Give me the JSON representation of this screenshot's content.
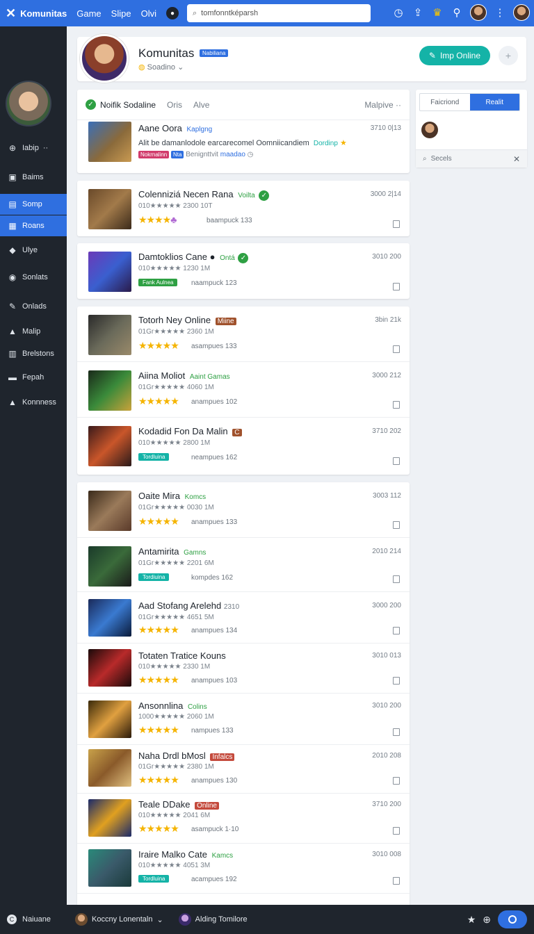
{
  "topbar": {
    "logo": "✕",
    "brand": "Komunitas",
    "nav": [
      "Game",
      "Slipe",
      "Olvi"
    ],
    "search_placeholder": "tomfonntképarsh",
    "icons": [
      "clock-icon",
      "upload-icon",
      "trophy-icon",
      "cart-icon",
      "more-icon"
    ]
  },
  "sidebar": {
    "items": [
      {
        "label": "Iabip",
        "icon": "⊕",
        "suffix": "··"
      },
      {
        "label": "Baims",
        "icon": "▣"
      },
      {
        "label": "Somp",
        "icon": "▤",
        "active": true
      },
      {
        "label": "Roans",
        "icon": "▦",
        "active": true
      },
      {
        "label": "Ulye",
        "icon": "◆"
      },
      {
        "label": "Sonlats",
        "icon": "◉"
      },
      {
        "label": "Onlads",
        "icon": "✎"
      },
      {
        "label": "Malip",
        "icon": "▲"
      },
      {
        "label": "Brelstons",
        "icon": "▥"
      },
      {
        "label": "Fepah",
        "icon": "▬"
      },
      {
        "label": "Konnness",
        "icon": "▲"
      }
    ]
  },
  "header": {
    "title": "Komunitas",
    "badge": "Nabiliana",
    "subtitle": "Soadino",
    "online_button": "Imp Online",
    "add_icon": "+"
  },
  "feed_head": {
    "title": "Noifik Sodaline",
    "tabs": [
      "Oris",
      "Alve"
    ],
    "right": "Malpive"
  },
  "first_post": {
    "title": "Aane Oora",
    "tag": "Kaplgng",
    "body": "Alit be damanlodole earcarecomel Oomniicandiem",
    "body_tag": "Dordinp",
    "chips": [
      "Nokrnalinn",
      "Nta"
    ],
    "chip_sub": "Benignttvit",
    "chip_link": "maadao",
    "num": "3710   0|13"
  },
  "rows": [
    {
      "title": "Colenniziá Necen Rana",
      "tag": "Voilta",
      "tag_style": "g",
      "meta": "010★★★★★ 2300 10T",
      "badge": "",
      "sub": "baampuck 133",
      "num": "3000   2|14",
      "group": 1
    },
    {
      "title": "Damtoklios Cane",
      "tag": "Ontá",
      "tag_style": "g",
      "meta": "010★★★★★ 1230 1M",
      "badge": "Fank Aulnea",
      "badge_style": "green",
      "sub": "naampuck 123",
      "num": "3010   200",
      "group": 2
    },
    {
      "title": "Totorh Ney Online",
      "tag": "Miine",
      "tag_style": "boxb",
      "meta": "01Gr★★★★★ 2360 1M",
      "badge": "",
      "sub": "asampues 133",
      "num": "3bin   21k",
      "group": 3
    },
    {
      "title": "Aiina Moliot",
      "tag": "Aaint Gamas",
      "tag_style": "g",
      "meta": "01Gr★★★★★ 4060 1M",
      "badge": "",
      "sub": "anampues 102",
      "num": "3000   212",
      "group": 3
    },
    {
      "title": "Kodadid Fon Da Malin",
      "tag": "C",
      "tag_style": "boxb",
      "meta": "010★★★★★ 2800 1M",
      "badge": "Tordluina",
      "badge_style": "teal",
      "sub": "neampues 162",
      "num": "3710   202",
      "group": 3
    },
    {
      "title": "Oaite Mira",
      "tag": "Komcs",
      "tag_style": "g",
      "meta": "01Gr★★★★★ 0030 1M",
      "badge": "",
      "sub": "anampues 133",
      "num": "3003   112",
      "group": 4
    },
    {
      "title": "Antamirita",
      "tag": "Gamns",
      "tag_style": "g",
      "meta": "01Gr★★★★★ 2201 6M",
      "badge": "Tordiuina",
      "badge_style": "teal",
      "sub": "kompdes 162",
      "num": "2010   214",
      "group": 4
    },
    {
      "title": "Aad Stofang Arelehd",
      "tag": "2310",
      "tag_style": "n",
      "meta": "01Gr★★★★★ 4651 5M",
      "badge": "",
      "sub": "anampues 134",
      "num": "3000   200",
      "group": 4
    },
    {
      "title": "Totaten Tratice Kouns",
      "tag": "",
      "tag_style": "n",
      "meta": "010★★★★★ 2330 1M",
      "badge": "",
      "sub": "anampues 103",
      "num": "3010   013",
      "group": 4
    },
    {
      "title": "Ansonnlina",
      "tag": "Colins",
      "tag_style": "g",
      "meta": "1000★★★★★ 2060 1M",
      "badge": "",
      "sub": "nampues 133",
      "num": "3010   200",
      "group": 4
    },
    {
      "title": "Naha Drdl bMosl",
      "tag": "Infalcs",
      "tag_style": "box",
      "meta": "01Gr★★★★★ 2380 1M",
      "badge": "",
      "sub": "anampues 130",
      "num": "2010   208",
      "group": 4
    },
    {
      "title": "Teale DDake",
      "tag": "Online",
      "tag_style": "box",
      "meta": "010★★★★★ 2041 6M",
      "badge": "",
      "sub": "asampuck 1·10",
      "num": "3710   200",
      "group": 4
    },
    {
      "title": "Iraire Malko Cate",
      "tag": "Kamcs",
      "tag_style": "g",
      "meta": "010★★★★★ 4051 3M",
      "badge": "Tordluina",
      "badge_style": "teal",
      "sub": "acampues 192",
      "num": "3010   008",
      "group": 4
    }
  ],
  "right_panel": {
    "tabs": [
      "Faicriond",
      "Realit"
    ],
    "search_placeholder": "Secels"
  },
  "bottombar": {
    "left": "Naiuane",
    "user": "Koccny Lonentaln",
    "right_user": "Alding Tomilore"
  }
}
